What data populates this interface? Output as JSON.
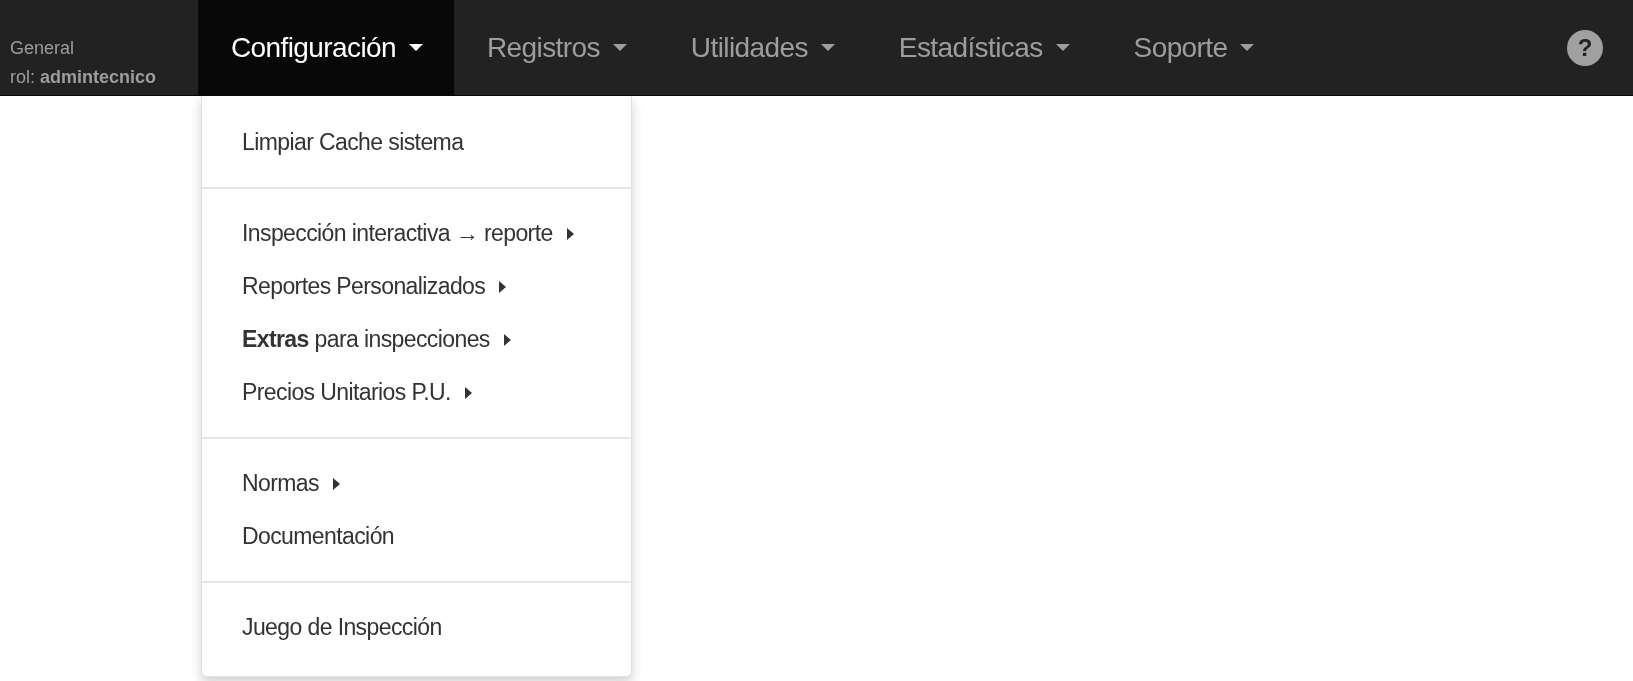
{
  "brand": {
    "line_1": "General",
    "role_label": "rol:",
    "role": "admintecnico"
  },
  "nav": [
    {
      "label": "Configuración",
      "selected": true
    },
    {
      "label": "Registros",
      "selected": false
    },
    {
      "label": "Utilidades",
      "selected": false
    },
    {
      "label": "Estadísticas",
      "selected": false
    },
    {
      "label": "Soporte",
      "selected": false
    }
  ],
  "help_button": {
    "label": "?"
  },
  "dropdown": {
    "groups": [
      [
        {
          "label": "Limpiar Cache sistema",
          "submenu": false
        }
      ],
      [
        {
          "label": "Inspección interactiva **→** reporte",
          "submenu": true
        },
        {
          "label": "Reportes Personalizados",
          "submenu": true
        },
        {
          "label": "**Extras** para inspecciones",
          "submenu": true
        },
        {
          "label": "Precios Unitarios P.U.",
          "submenu": true
        }
      ],
      [
        {
          "label": "Normas",
          "submenu": true
        },
        {
          "label": "Documentación",
          "submenu": false
        }
      ],
      [
        {
          "label": "Juego de Inspección",
          "submenu": false
        }
      ]
    ]
  }
}
